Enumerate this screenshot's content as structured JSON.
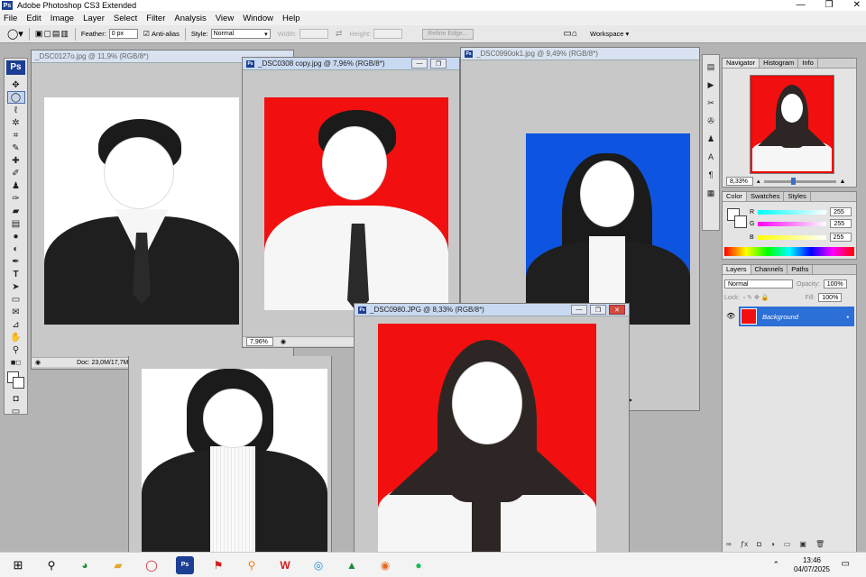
{
  "app": {
    "title": "Adobe Photoshop CS3 Extended",
    "badge": "Ps"
  },
  "window_controls": {
    "minimize": "—",
    "restore": "❐",
    "close": "✕"
  },
  "menu": [
    "File",
    "Edit",
    "Image",
    "Layer",
    "Select",
    "Filter",
    "Analysis",
    "View",
    "Window",
    "Help"
  ],
  "options": {
    "feather_label": "Feather:",
    "feather_value": "0 px",
    "antialias_label": "Anti-alias",
    "style_label": "Style:",
    "style_value": "Normal",
    "width_label": "Width:",
    "height_label": "Height:",
    "refine_edge": "Refine Edge...",
    "workspace": "Workspace ▾"
  },
  "documents": [
    {
      "title": "_DSC0127o.jpg @ 11,9% (RGB/8*)",
      "status": "Doc: 23,0M/17,7M"
    },
    {
      "title": "_DSC0308 copy.jpg @ 7,96% (RGB/8*)",
      "zoom": "7,96%"
    },
    {
      "title": "_DSC0990ok1.jpg @ 9,49% (RGB/8*)"
    },
    {
      "title": "_DSC0980.JPG @ 8,33% (RGB/8*)"
    }
  ],
  "navigator": {
    "tabs": [
      "Navigator",
      "Histogram",
      "Info"
    ],
    "zoom": "8,33%"
  },
  "color_panel": {
    "tabs": [
      "Color",
      "Swatches",
      "Styles"
    ],
    "channels": [
      {
        "label": "R",
        "value": "255"
      },
      {
        "label": "G",
        "value": "255"
      },
      {
        "label": "B",
        "value": "255"
      }
    ]
  },
  "layers_panel": {
    "tabs": [
      "Layers",
      "Channels",
      "Paths"
    ],
    "blend_mode": "Normal",
    "opacity_label": "Opacity:",
    "opacity_value": "100%",
    "lock_label": "Lock:",
    "fill_label": "Fill:",
    "fill_value": "100%",
    "layer_name": "Background"
  },
  "taskbar": {
    "time": "13:46",
    "date": "04/07/2025"
  },
  "colors": {
    "red_bg": "#f20f0f",
    "blue_bg": "#0d55e0",
    "ps_blue": "#1c3f94"
  }
}
